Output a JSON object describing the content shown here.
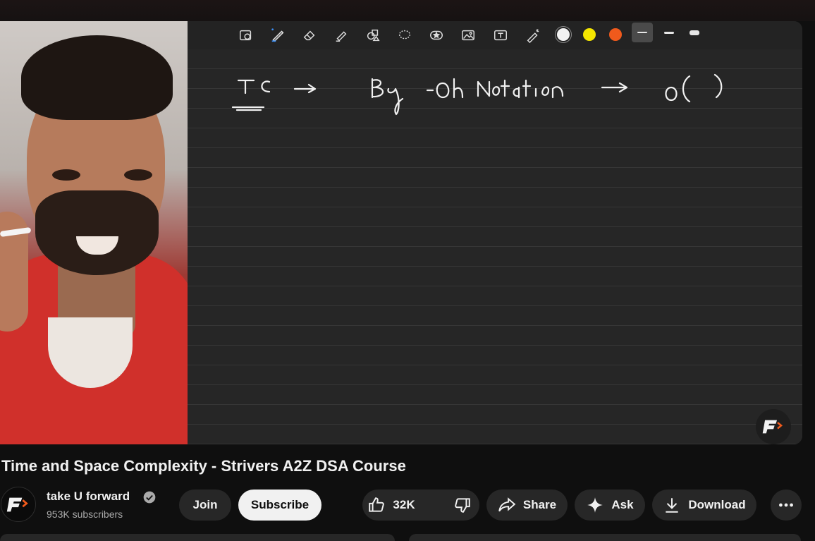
{
  "video": {
    "title": "Time and Space Complexity - Strivers A2Z DSA Course",
    "board_text": {
      "tc": "TC",
      "bigoh": "Big-Oh Notation",
      "o": "O( )"
    },
    "toolbar_colors": [
      "#f2f2f2",
      "#f4e600",
      "#f05a1c"
    ]
  },
  "channel": {
    "name": "take U forward",
    "subscribers": "953K subscribers"
  },
  "actions": {
    "join": "Join",
    "subscribe": "Subscribe",
    "likes": "32K",
    "share": "Share",
    "ask": "Ask",
    "download": "Download"
  },
  "icons": [
    "pen-icon",
    "eraser-icon",
    "highlighter-icon",
    "shapes-icon",
    "lasso-icon",
    "sticker-icon",
    "image-icon",
    "text-icon",
    "laser-icon",
    "like-icon",
    "dislike-icon",
    "share-icon",
    "sparkle-icon",
    "download-icon",
    "more-icon",
    "verified-icon"
  ]
}
